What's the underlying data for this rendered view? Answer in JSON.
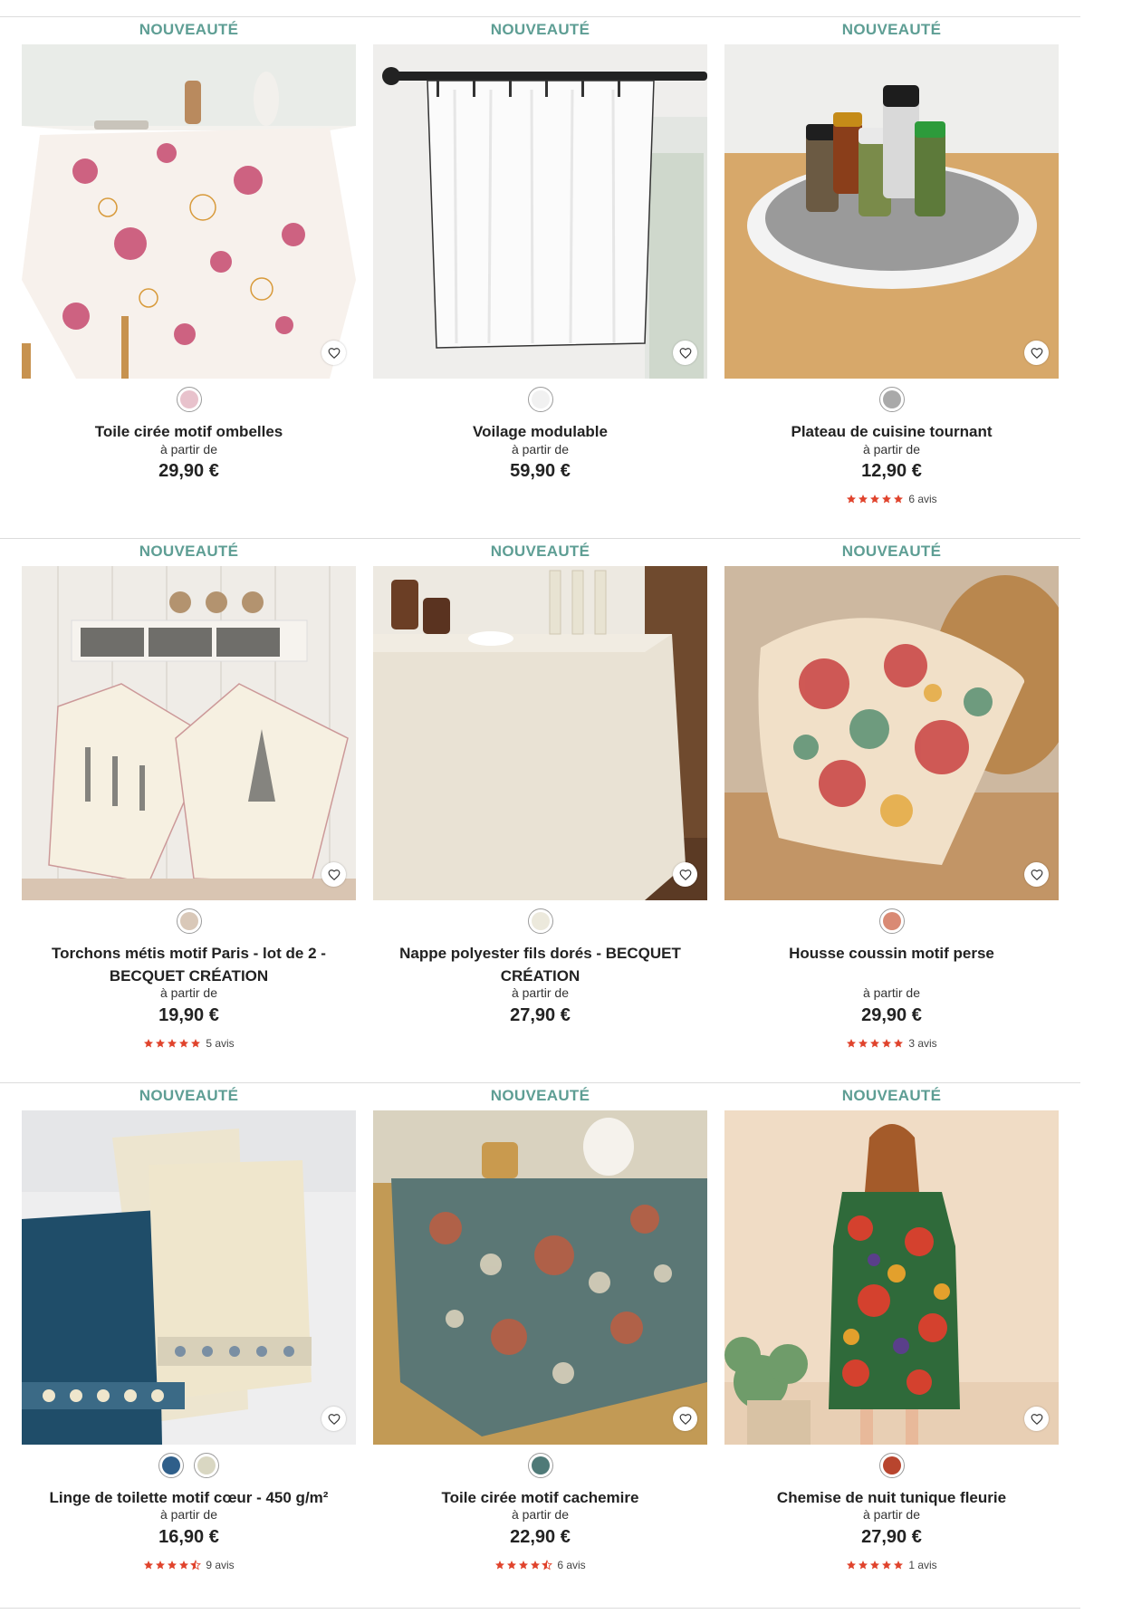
{
  "colors": {
    "badge": "#5e9e94",
    "star": "#e0432c",
    "text": "#222222",
    "rule": "#dcdcdc"
  },
  "products": [
    {
      "badge": "NOUVEAUTÉ",
      "name": "Toile cirée motif ombelles",
      "from": "à partir de",
      "price": "29,90 €",
      "swatches": [
        "#e8c2cc"
      ],
      "image": "tablecloth-floral",
      "rating": null
    },
    {
      "badge": "NOUVEAUTÉ",
      "name": "Voilage modulable",
      "from": "à partir de",
      "price": "59,90 €",
      "swatches": [
        "#f1f1f1"
      ],
      "image": "curtain-white",
      "rating": null
    },
    {
      "badge": "NOUVEAUTÉ",
      "name": "Plateau de cuisine tournant",
      "from": "à partir de",
      "price": "12,90 €",
      "swatches": [
        "#a9a9a9"
      ],
      "image": "spice-turntable",
      "rating": {
        "stars": 5,
        "text": "6 avis"
      }
    },
    {
      "badge": "NOUVEAUTÉ",
      "name": "Torchons métis motif Paris - lot de 2 - BECQUET CRÉATION",
      "from": "à partir de",
      "price": "19,90 €",
      "swatches": [
        "#d9c8b8"
      ],
      "image": "tea-towels-paris",
      "rating": {
        "stars": 5,
        "text": "5 avis"
      }
    },
    {
      "badge": "NOUVEAUTÉ",
      "name": "Nappe polyester fils dorés - BECQUET CRÉATION",
      "from": "à partir de",
      "price": "27,90 €",
      "swatches": [
        "#ece9dc"
      ],
      "image": "tablecloth-linen",
      "rating": null
    },
    {
      "badge": "NOUVEAUTÉ",
      "name": "Housse coussin motif perse",
      "from": "à partir de",
      "price": "29,90 €",
      "swatches": [
        "#d98a74"
      ],
      "image": "cushion-persian",
      "rating": {
        "stars": 5,
        "text": "3 avis"
      }
    },
    {
      "badge": "NOUVEAUTÉ",
      "name": "Linge de toilette motif cœur - 450 g/m²",
      "from": "à partir de",
      "price": "16,90 €",
      "swatches": [
        "#2f5f8a",
        "#d9d7c2"
      ],
      "image": "towels-heart",
      "rating": {
        "stars": 4.5,
        "text": "9 avis"
      }
    },
    {
      "badge": "NOUVEAUTÉ",
      "name": "Toile cirée motif cachemire",
      "from": "à partir de",
      "price": "22,90 €",
      "swatches": [
        "#4f7a78"
      ],
      "image": "tablecloth-paisley",
      "rating": {
        "stars": 4.5,
        "text": "6 avis"
      }
    },
    {
      "badge": "NOUVEAUTÉ",
      "name": "Chemise de nuit tunique fleurie",
      "from": "à partir de",
      "price": "27,90 €",
      "swatches": [
        "#b8452e"
      ],
      "image": "nightdress-floral",
      "rating": {
        "stars": 5,
        "text": "1 avis"
      }
    }
  ]
}
